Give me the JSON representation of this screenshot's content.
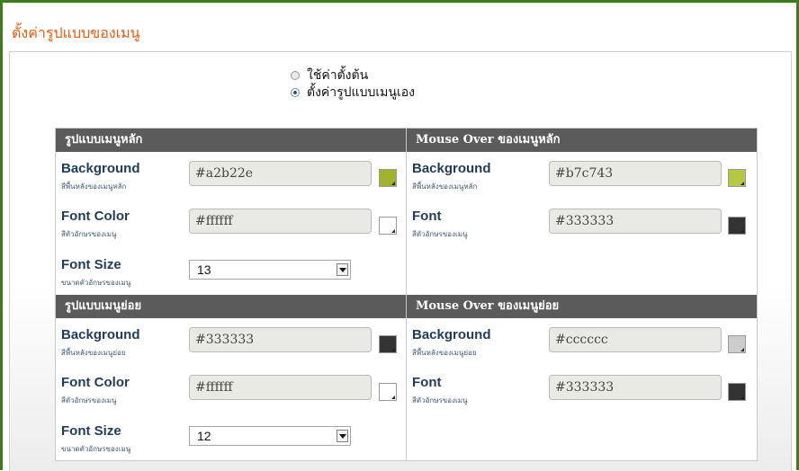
{
  "page_title": "ตั้งค่ารูปแบบของเมนู",
  "mode": {
    "options": [
      "ใช้ค่าตั้งต้น",
      "ตั้งค่ารูปแบบเมนูเอง"
    ],
    "selected_index": 1
  },
  "sections": {
    "main_menu": {
      "header": "รูปแบบเมนูหลัก",
      "background": {
        "label": "Background",
        "sub": "สีพื้นหลังของเมนูหลัก",
        "value": "#a2b22e",
        "swatch": "#a2b22e"
      },
      "font_color": {
        "label": "Font Color",
        "sub": "สีตัวอักษรของเมนู",
        "value": "#ffffff",
        "swatch": "#ffffff"
      },
      "font_size": {
        "label": "Font Size",
        "sub": "ขนาดตัวอักษรของเมนู",
        "value": "13"
      }
    },
    "main_hover": {
      "header": "Mouse Over ของเมนูหลัก",
      "background": {
        "label": "Background",
        "sub": "สีพื้นหลังของเมนูหลัก",
        "value": "#b7c743",
        "swatch": "#b7c743"
      },
      "font": {
        "label": "Font",
        "sub": "สีตัวอักษรของเมนู",
        "value": "#333333",
        "swatch": "#333333"
      }
    },
    "sub_menu": {
      "header": "รูปแบบเมนูย่อย",
      "background": {
        "label": "Background",
        "sub": "สีพื้นหลังของเมนูย่อย",
        "value": "#333333",
        "swatch": "#333333"
      },
      "font_color": {
        "label": "Font Color",
        "sub": "สีตัวอักษรของเมนู",
        "value": "#ffffff",
        "swatch": "#ffffff"
      },
      "font_size": {
        "label": "Font Size",
        "sub": "ขนาดตัวอักษรของเมนู",
        "value": "12"
      }
    },
    "sub_hover": {
      "header": "Mouse Over ของเมนูย่อย",
      "background": {
        "label": "Background",
        "sub": "สีพื้นหลังของเมนูย่อย",
        "value": "#cccccc",
        "swatch": "#cccccc"
      },
      "font": {
        "label": "Font",
        "sub": "สีตัวอักษรของเมนู",
        "value": "#333333",
        "swatch": "#333333"
      }
    }
  },
  "colors": {
    "frame_border": "#3b7d1d",
    "title": "#ea5a0c",
    "section_header_bg": "#5b5b5b"
  }
}
